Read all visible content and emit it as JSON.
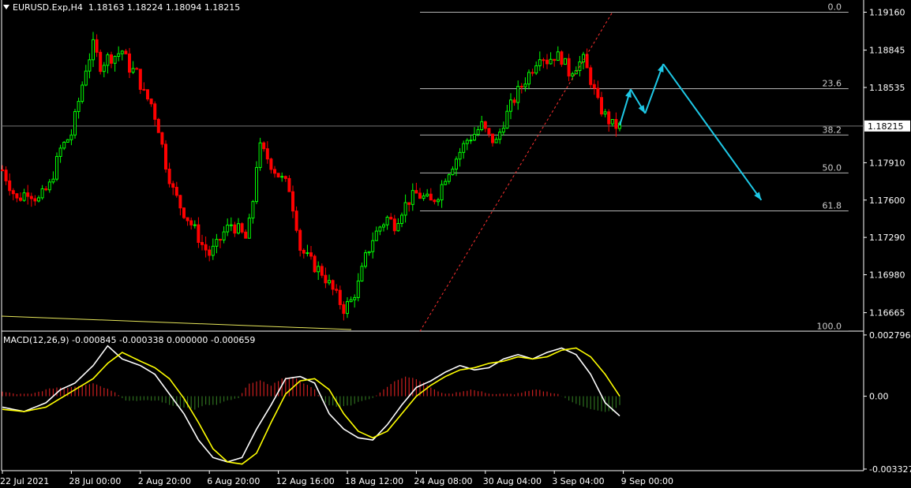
{
  "header": {
    "symbol": "EURUSD.Exp,H4",
    "ohlc": "1.18163 1.18224 1.18094 1.18215"
  },
  "macd_header": "MACD(12,26,9) -0.000845 -0.000338 0.000000 -0.000659",
  "colors": {
    "background": "#000000",
    "bull": "#00ff00",
    "bear": "#ff0000",
    "fib": "#b4b4b4",
    "forecast": "#1ec8e6",
    "macd_main": "#ffffff",
    "macd_signal": "#ffff00",
    "hist_pos": "#c81e1e",
    "hist_neg": "#2d6e1e",
    "trendline": "#e6e65a"
  },
  "chart_data": [
    {
      "type": "candlestick",
      "title": "EURUSD.Exp,H4",
      "ylim": [
        1.16525,
        1.19235
      ],
      "y_ticks": [
        1.1916,
        1.18845,
        1.18535,
        1.1791,
        1.176,
        1.1729,
        1.1698,
        1.16665
      ],
      "current_price": 1.18215,
      "close_path": [
        [
          0,
          1.1785
        ],
        [
          4,
          1.176
        ],
        [
          7,
          1.1768
        ],
        [
          10,
          1.176
        ],
        [
          13,
          1.1772
        ],
        [
          16,
          1.1802
        ],
        [
          19,
          1.1815
        ],
        [
          21,
          1.1842
        ],
        [
          23,
          1.187
        ],
        [
          25,
          1.1888
        ],
        [
          27,
          1.1872
        ],
        [
          29,
          1.1878
        ],
        [
          31,
          1.188
        ],
        [
          33,
          1.1884
        ],
        [
          35,
          1.187
        ],
        [
          37,
          1.1865
        ],
        [
          39,
          1.1848
        ],
        [
          41,
          1.184
        ],
        [
          43,
          1.182
        ],
        [
          45,
          1.179
        ],
        [
          47,
          1.1768
        ],
        [
          49,
          1.1755
        ],
        [
          51,
          1.1745
        ],
        [
          53,
          1.1735
        ],
        [
          55,
          1.1723
        ],
        [
          57,
          1.1715
        ],
        [
          59,
          1.1722
        ],
        [
          61,
          1.1733
        ],
        [
          63,
          1.174
        ],
        [
          65,
          1.1735
        ],
        [
          67,
          1.1728
        ],
        [
          68,
          1.174
        ],
        [
          69,
          1.176
        ],
        [
          70,
          1.179
        ],
        [
          71,
          1.1803
        ],
        [
          73,
          1.1795
        ],
        [
          75,
          1.1785
        ],
        [
          77,
          1.1777
        ],
        [
          79,
          1.177
        ],
        [
          81,
          1.174
        ],
        [
          82,
          1.172
        ],
        [
          84,
          1.1712
        ],
        [
          86,
          1.1705
        ],
        [
          88,
          1.17
        ],
        [
          90,
          1.169
        ],
        [
          92,
          1.168
        ],
        [
          94,
          1.167
        ],
        [
          96,
          1.1676
        ],
        [
          98,
          1.169
        ],
        [
          100,
          1.1712
        ],
        [
          102,
          1.1728
        ],
        [
          104,
          1.1738
        ],
        [
          106,
          1.1745
        ],
        [
          108,
          1.174
        ],
        [
          110,
          1.1752
        ],
        [
          112,
          1.176
        ],
        [
          114,
          1.1765
        ],
        [
          116,
          1.1762
        ],
        [
          118,
          1.1758
        ],
        [
          120,
          1.1765
        ],
        [
          122,
          1.178
        ],
        [
          124,
          1.179
        ],
        [
          126,
          1.18
        ],
        [
          128,
          1.181
        ],
        [
          130,
          1.1815
        ],
        [
          132,
          1.1822
        ],
        [
          134,
          1.1812
        ],
        [
          136,
          1.1808
        ],
        [
          138,
          1.1825
        ],
        [
          140,
          1.1838
        ],
        [
          142,
          1.185
        ],
        [
          144,
          1.186
        ],
        [
          146,
          1.187
        ],
        [
          148,
          1.1882
        ],
        [
          150,
          1.1876
        ],
        [
          152,
          1.188
        ],
        [
          154,
          1.1878
        ],
        [
          156,
          1.1866
        ],
        [
          158,
          1.1872
        ],
        [
          160,
          1.1876
        ],
        [
          162,
          1.186
        ],
        [
          164,
          1.184
        ],
        [
          166,
          1.183
        ],
        [
          168,
          1.1822
        ],
        [
          170,
          1.1821
        ]
      ]
    },
    {
      "type": "fibonacci",
      "levels": [
        {
          "label": "0.0",
          "price": 1.1916
        },
        {
          "label": "23.6",
          "price": 1.18525
        },
        {
          "label": "38.2",
          "price": 1.1814
        },
        {
          "label": "50.0",
          "price": 1.17825
        },
        {
          "label": "61.8",
          "price": 1.1751
        },
        {
          "label": "100.0",
          "price": 1.1651
        }
      ]
    },
    {
      "type": "line",
      "series": [
        {
          "points": [
            [
              170,
              1.1822
            ],
            [
              173,
              1.1852
            ],
            [
              177,
              1.1832
            ],
            [
              182,
              1.1873
            ],
            [
              209,
              1.176
            ]
          ]
        }
      ]
    },
    {
      "type": "line",
      "title": "MACD(12,26,9)",
      "ylim": [
        -0.0034,
        0.0029
      ],
      "y_ticks": [
        {
          "label": "0.002796",
          "value": 0.002796
        },
        {
          "label": "0.00",
          "value": 0.0
        },
        {
          "label": "-0.003327",
          "value": -0.003327
        }
      ],
      "series": [
        {
          "name": "main",
          "points": [
            [
              0,
              -0.0005
            ],
            [
              6,
              -0.0007
            ],
            [
              12,
              -0.0003
            ],
            [
              16,
              0.0003
            ],
            [
              20,
              0.0006
            ],
            [
              25,
              0.0014
            ],
            [
              29,
              0.0023
            ],
            [
              33,
              0.0017
            ],
            [
              38,
              0.0014
            ],
            [
              42,
              0.001
            ],
            [
              46,
              0.0001
            ],
            [
              50,
              -0.0008
            ],
            [
              54,
              -0.002
            ],
            [
              58,
              -0.0028
            ],
            [
              62,
              -0.003
            ],
            [
              66,
              -0.0028
            ],
            [
              70,
              -0.0015
            ],
            [
              74,
              -0.0004
            ],
            [
              78,
              0.0008
            ],
            [
              82,
              0.0009
            ],
            [
              86,
              0.0006
            ],
            [
              90,
              -0.0008
            ],
            [
              94,
              -0.0015
            ],
            [
              98,
              -0.0019
            ],
            [
              102,
              -0.002
            ],
            [
              106,
              -0.0013
            ],
            [
              110,
              -0.0004
            ],
            [
              114,
              0.0004
            ],
            [
              118,
              0.0007
            ],
            [
              122,
              0.0011
            ],
            [
              126,
              0.0014
            ],
            [
              130,
              0.0012
            ],
            [
              134,
              0.0013
            ],
            [
              138,
              0.0017
            ],
            [
              142,
              0.0019
            ],
            [
              146,
              0.0017
            ],
            [
              150,
              0.002
            ],
            [
              154,
              0.0022
            ],
            [
              158,
              0.0019
            ],
            [
              162,
              0.001
            ],
            [
              166,
              -0.0003
            ],
            [
              170,
              -0.0009
            ]
          ]
        },
        {
          "name": "signal",
          "points": [
            [
              0,
              -0.0006
            ],
            [
              6,
              -0.0007
            ],
            [
              12,
              -0.0005
            ],
            [
              16,
              -0.0001
            ],
            [
              20,
              0.0003
            ],
            [
              25,
              0.0008
            ],
            [
              29,
              0.0015
            ],
            [
              33,
              0.002
            ],
            [
              38,
              0.0016
            ],
            [
              42,
              0.0013
            ],
            [
              46,
              0.0008
            ],
            [
              50,
              -0.0001
            ],
            [
              54,
              -0.0012
            ],
            [
              58,
              -0.0024
            ],
            [
              62,
              -0.003
            ],
            [
              66,
              -0.0031
            ],
            [
              70,
              -0.0026
            ],
            [
              74,
              -0.0012
            ],
            [
              78,
              0.0001
            ],
            [
              82,
              0.0007
            ],
            [
              86,
              0.0008
            ],
            [
              90,
              0.0003
            ],
            [
              94,
              -0.0008
            ],
            [
              98,
              -0.0016
            ],
            [
              102,
              -0.0019
            ],
            [
              106,
              -0.0016
            ],
            [
              110,
              -0.0008
            ],
            [
              114,
              0.0
            ],
            [
              118,
              0.0005
            ],
            [
              122,
              0.0009
            ],
            [
              126,
              0.0012
            ],
            [
              130,
              0.0013
            ],
            [
              134,
              0.0015
            ],
            [
              138,
              0.0016
            ],
            [
              142,
              0.0018
            ],
            [
              146,
              0.0017
            ],
            [
              150,
              0.0018
            ],
            [
              154,
              0.0021
            ],
            [
              158,
              0.0022
            ],
            [
              162,
              0.0018
            ],
            [
              166,
              0.001
            ],
            [
              170,
              0.0
            ]
          ]
        },
        {
          "name": "histogram",
          "points": [
            [
              0,
              0.0002
            ],
            [
              4,
              0.0001
            ],
            [
              8,
              0.0001
            ],
            [
              12,
              0.0003
            ],
            [
              15,
              0.0004
            ],
            [
              18,
              0.0004
            ],
            [
              22,
              0.0005
            ],
            [
              25,
              0.0006
            ],
            [
              28,
              0.0004
            ],
            [
              31,
              0.0002
            ],
            [
              34,
              -0.0002
            ],
            [
              37,
              -0.0002
            ],
            [
              40,
              -0.0002
            ],
            [
              43,
              -0.0002
            ],
            [
              46,
              -0.0004
            ],
            [
              50,
              -0.0005
            ],
            [
              53,
              -0.0006
            ],
            [
              56,
              -0.0004
            ],
            [
              59,
              -0.0004
            ],
            [
              62,
              -0.0002
            ],
            [
              65,
              -0.0001
            ],
            [
              68,
              0.0006
            ],
            [
              71,
              0.0007
            ],
            [
              74,
              0.0005
            ],
            [
              77,
              0.0008
            ],
            [
              80,
              0.0009
            ],
            [
              83,
              0.0006
            ],
            [
              86,
              0.0003
            ],
            [
              88,
              -0.0002
            ],
            [
              90,
              -0.0004
            ],
            [
              93,
              -0.0005
            ],
            [
              96,
              -0.0004
            ],
            [
              99,
              -0.0002
            ],
            [
              102,
              -0.0001
            ],
            [
              105,
              0.0003
            ],
            [
              108,
              0.0007
            ],
            [
              111,
              0.0009
            ],
            [
              114,
              0.0008
            ],
            [
              117,
              0.0005
            ],
            [
              120,
              0.0002
            ],
            [
              123,
              0.0001
            ],
            [
              126,
              0.0002
            ],
            [
              129,
              0.0003
            ],
            [
              132,
              0.0002
            ],
            [
              135,
              0.0001
            ],
            [
              138,
              0.0001
            ],
            [
              141,
              0.0001
            ],
            [
              144,
              0.0002
            ],
            [
              147,
              0.0003
            ],
            [
              150,
              0.0002
            ],
            [
              153,
              0.0001
            ],
            [
              156,
              -0.0002
            ],
            [
              159,
              -0.0004
            ],
            [
              162,
              -0.0006
            ],
            [
              165,
              -0.0007
            ],
            [
              168,
              -0.0007
            ],
            [
              170,
              -0.0004
            ]
          ]
        }
      ]
    }
  ],
  "x_axis": {
    "bars_total": 210,
    "labels": [
      {
        "text": "22 Jul 2021",
        "bar": 0
      },
      {
        "text": "28 Jul 00:00",
        "bar": 19
      },
      {
        "text": "2 Aug 20:00",
        "bar": 38
      },
      {
        "text": "6 Aug 20:00",
        "bar": 57
      },
      {
        "text": "12 Aug 16:00",
        "bar": 76
      },
      {
        "text": "18 Aug 12:00",
        "bar": 95
      },
      {
        "text": "24 Aug 08:00",
        "bar": 114
      },
      {
        "text": "30 Aug 04:00",
        "bar": 133
      },
      {
        "text": "3 Sep 04:00",
        "bar": 152
      },
      {
        "text": "9 Sep 00:00",
        "bar": 171
      }
    ]
  }
}
